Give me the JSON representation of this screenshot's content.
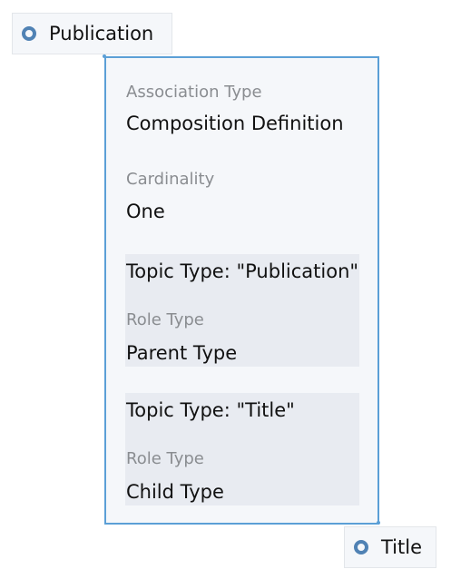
{
  "source_topic": {
    "label": "Publication",
    "icon": "topic-circle-icon"
  },
  "target_topic": {
    "label": "Title",
    "icon": "topic-circle-icon"
  },
  "association": {
    "type_label": "Association Type",
    "type_value": "Composition Definition",
    "cardinality_label": "Cardinality",
    "cardinality_value": "One"
  },
  "roles": [
    {
      "topic": "Topic Type: \"Publication\"",
      "role_label": "Role Type",
      "role_value": "Parent Type"
    },
    {
      "topic": "Topic Type: \"Title\"",
      "role_label": "Role Type",
      "role_value": "Child Type"
    }
  ],
  "colors": {
    "border_accent": "#5b9fd6",
    "icon_ring": "#5082b4",
    "card_bg": "#f5f7fa",
    "role_box_bg": "#e8ebf1",
    "label_gray": "#8a8d91"
  }
}
